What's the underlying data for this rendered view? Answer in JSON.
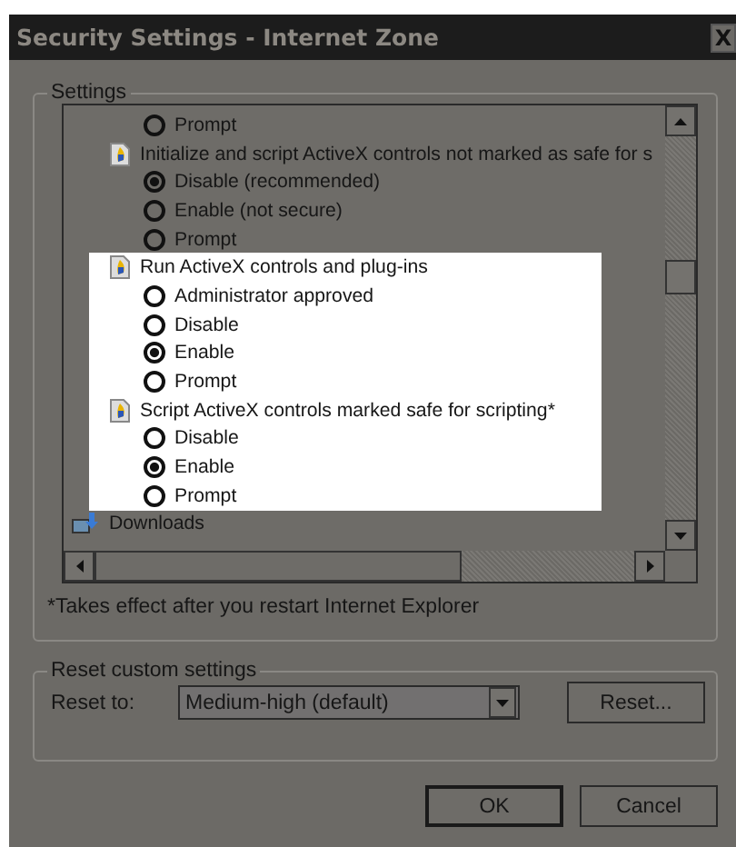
{
  "window": {
    "title": "Security Settings - Internet Zone",
    "close": "X"
  },
  "settings": {
    "legend": "Settings",
    "rows": [
      {
        "kind": "option",
        "label": "Prompt",
        "selected": false,
        "highlighted": false
      },
      {
        "kind": "setting",
        "label": "Initialize and script ActiveX controls not marked as safe for s",
        "highlighted": false
      },
      {
        "kind": "option",
        "label": "Disable (recommended)",
        "selected": true,
        "highlighted": false
      },
      {
        "kind": "option",
        "label": "Enable (not secure)",
        "selected": false,
        "highlighted": false
      },
      {
        "kind": "option",
        "label": "Prompt",
        "selected": false,
        "highlighted": false
      },
      {
        "kind": "setting",
        "label": "Run ActiveX controls and plug-ins",
        "highlighted": true
      },
      {
        "kind": "option",
        "label": "Administrator approved",
        "selected": false,
        "highlighted": true
      },
      {
        "kind": "option",
        "label": "Disable",
        "selected": false,
        "highlighted": true
      },
      {
        "kind": "option",
        "label": "Enable",
        "selected": true,
        "highlighted": true
      },
      {
        "kind": "option",
        "label": "Prompt",
        "selected": false,
        "highlighted": true
      },
      {
        "kind": "setting",
        "label": "Script ActiveX controls marked safe for scripting*",
        "highlighted": true
      },
      {
        "kind": "option",
        "label": "Disable",
        "selected": false,
        "highlighted": true
      },
      {
        "kind": "option",
        "label": "Enable",
        "selected": true,
        "highlighted": true
      },
      {
        "kind": "option",
        "label": "Prompt",
        "selected": false,
        "highlighted": true
      },
      {
        "kind": "category",
        "label": "Downloads",
        "highlighted": false
      }
    ],
    "note": "*Takes effect after you restart Internet Explorer"
  },
  "reset": {
    "legend": "Reset custom settings",
    "label": "Reset to:",
    "value": "Medium-high (default)",
    "button": "Reset..."
  },
  "buttons": [
    "OK",
    "Cancel"
  ]
}
